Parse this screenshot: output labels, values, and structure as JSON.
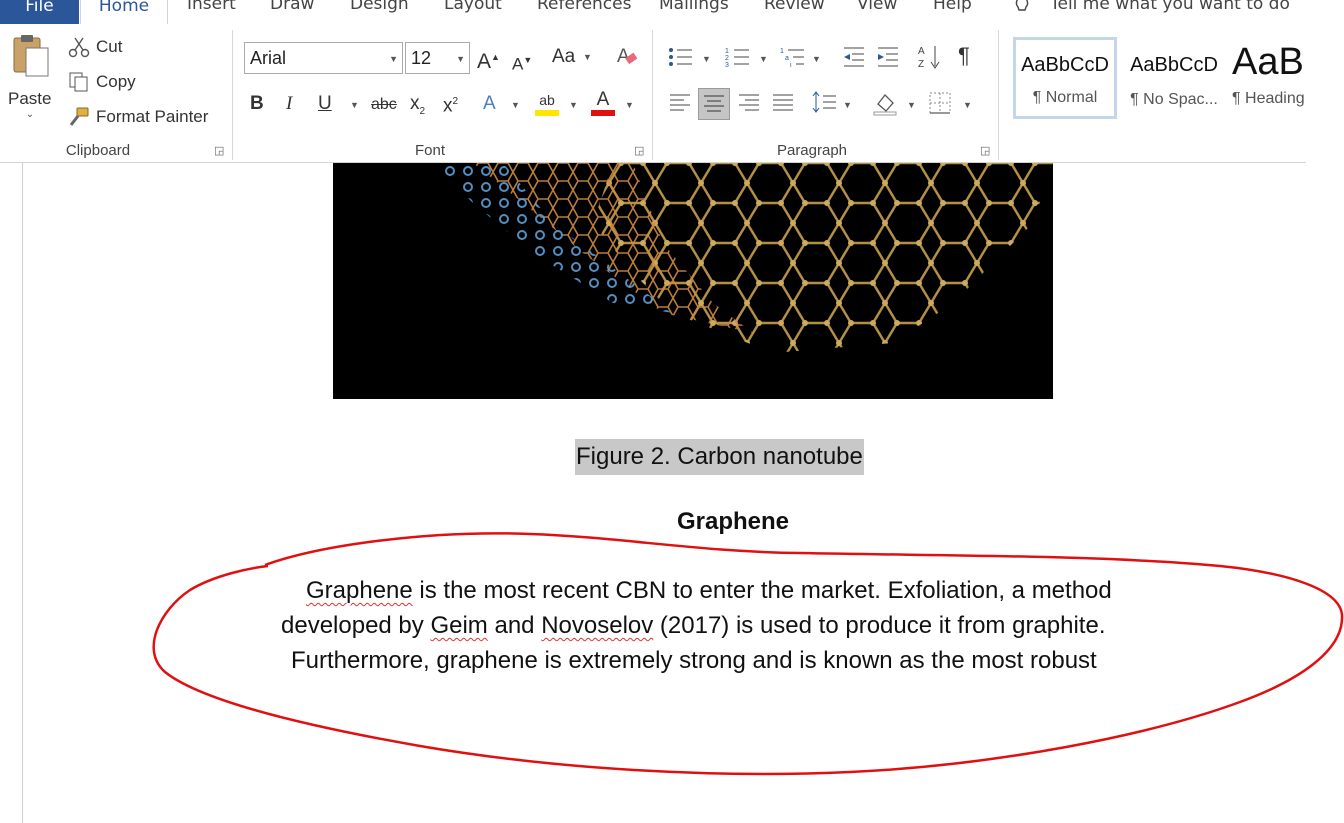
{
  "tabs": [
    "File",
    "Home",
    "Insert",
    "Draw",
    "Design",
    "Layout",
    "References",
    "Mailings",
    "Review",
    "View",
    "Help"
  ],
  "tell_me": "Tell me what you want to do",
  "clipboard": {
    "paste": "Paste",
    "cut": "Cut",
    "copy": "Copy",
    "format_painter": "Format Painter",
    "label": "Clipboard"
  },
  "font": {
    "name": "Arial",
    "size": "12",
    "label": "Font",
    "grow": "A",
    "shrink": "A",
    "case": "Aa",
    "bold": "B",
    "italic": "I",
    "underline": "U",
    "strike": "abc",
    "sub": "x",
    "sup": "x",
    "highlight": "ab",
    "color": "A"
  },
  "paragraph": {
    "label": "Paragraph",
    "pilcrow": "¶"
  },
  "styles": [
    {
      "sample": "AaBbCcD",
      "name": "¶ Normal"
    },
    {
      "sample": "AaBbCcD",
      "name": "¶ No Spac..."
    },
    {
      "sample": "AaB",
      "name": "¶ Heading"
    }
  ],
  "document": {
    "caption": "Figure 2. Carbon nanotube",
    "heading": "Graphene",
    "line1_a": "Graphene",
    "line1_b": " is the most recent CBN to enter the market. Exfoliation, a method",
    "line2_a": "developed by ",
    "line2_b": "Geim",
    "line2_c": " and ",
    "line2_d": "Novoselov",
    "line2_e": " (2017) is used to produce it from graphite.",
    "line3": "Furthermore, graphene is extremely strong and is known as the most robust"
  },
  "colors": {
    "file_tab": "#2b579a",
    "annotation": "#e01010",
    "highlight": "#ffe600",
    "font_color": "#e01010"
  }
}
